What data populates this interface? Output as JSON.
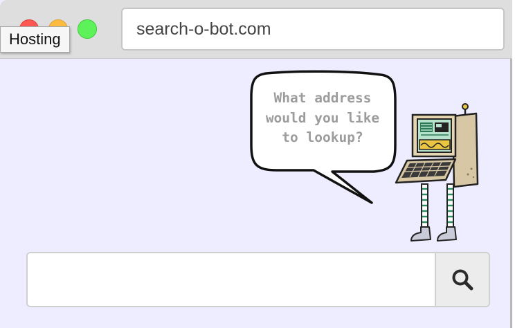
{
  "tooltip": {
    "text": "Hosting"
  },
  "address_bar": {
    "url": "search-o-bot.com"
  },
  "speech_bubble": {
    "text": "What address\nwould you like\nto lookup?"
  },
  "search": {
    "value": "",
    "placeholder": "",
    "button_icon": "search-icon"
  },
  "colors": {
    "page_background": "#eeecff",
    "close": "#fc5753",
    "minimize": "#fdbc40",
    "zoom": "#5df25a"
  }
}
